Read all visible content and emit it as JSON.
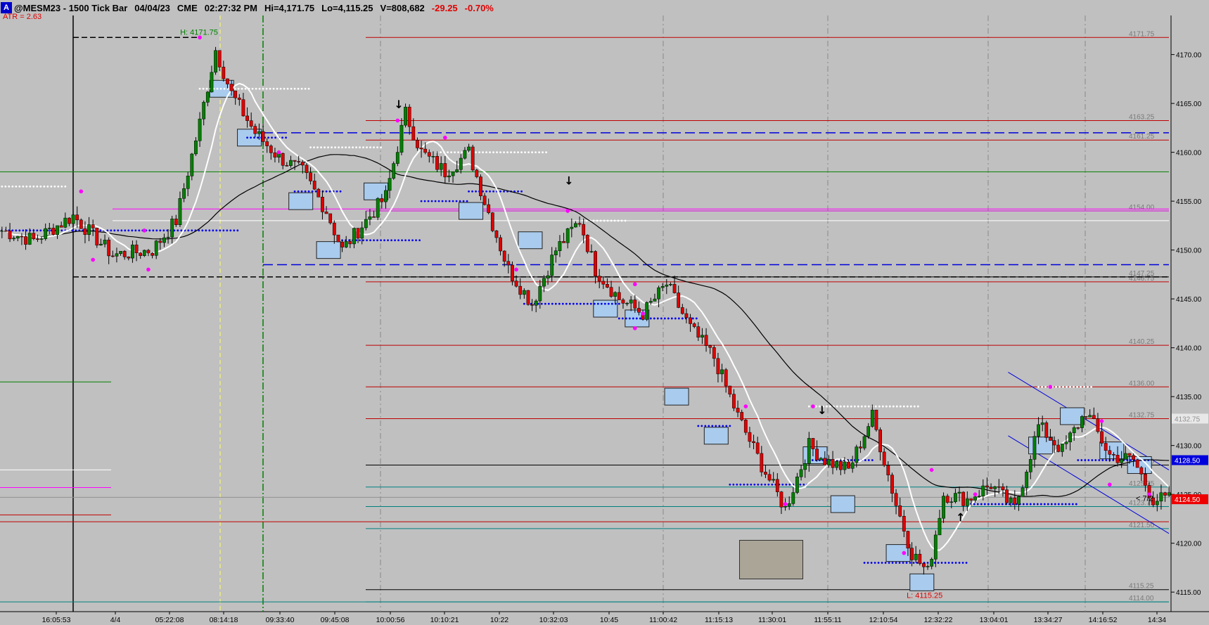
{
  "header": {
    "badge": "A",
    "symbol": "@MESM23 - 1500 Tick Bar",
    "date": "04/04/23",
    "exchange": "CME",
    "time": "02:27:32 PM",
    "hi": "Hi=4,171.75",
    "lo": "Lo=4,115.25",
    "volume": "V=808,682",
    "change": "-29.25",
    "change_pct": "-0.70%"
  },
  "atr_label": "ATR  = 2.63",
  "chart_data": {
    "type": "candlestick",
    "y_range": [
      4113,
      4174
    ],
    "y_ticks": [
      4115,
      4120,
      4125,
      4130,
      4135,
      4140,
      4145,
      4150,
      4155,
      4160,
      4165,
      4170
    ],
    "y_tick_labels": [
      "4115.00",
      "4120.00",
      "4125.00",
      "4130.00",
      "4135.00",
      "4140.00",
      "4145.00",
      "4150.00",
      "4155.00",
      "4160.00",
      "4165.00",
      "4170.00"
    ],
    "x_labels": [
      "16:05:53",
      "4/4",
      "05:22:08",
      "08:14:18",
      "09:33:40",
      "09:45:08",
      "10:00:56",
      "10:10:21",
      "10:22",
      "10:32:03",
      "10:45",
      "11:00:42",
      "11:15:13",
      "11:30:01",
      "11:55:11",
      "12:10:54",
      "12:32:22",
      "13:04:01",
      "13:34:27",
      "14:16:52",
      "14:34"
    ],
    "bar_count": 296,
    "close_path": [
      [
        0,
        4152
      ],
      [
        8,
        4151
      ],
      [
        18,
        4153.5
      ],
      [
        28,
        4149.5
      ],
      [
        38,
        4150
      ],
      [
        44,
        4153
      ],
      [
        50,
        4163
      ],
      [
        54,
        4170.5
      ],
      [
        58,
        4166
      ],
      [
        64,
        4162
      ],
      [
        70,
        4159.5
      ],
      [
        76,
        4158
      ],
      [
        82,
        4154
      ],
      [
        86,
        4150
      ],
      [
        92,
        4153
      ],
      [
        97,
        4155.5
      ],
      [
        102,
        4164
      ],
      [
        106,
        4160
      ],
      [
        112,
        4158
      ],
      [
        118,
        4160
      ],
      [
        122,
        4155
      ],
      [
        128,
        4148
      ],
      [
        134,
        4144.5
      ],
      [
        140,
        4150
      ],
      [
        146,
        4153
      ],
      [
        150,
        4148
      ],
      [
        156,
        4145
      ],
      [
        162,
        4143.5
      ],
      [
        168,
        4146.5
      ],
      [
        174,
        4142
      ],
      [
        180,
        4139
      ],
      [
        186,
        4133
      ],
      [
        192,
        4128
      ],
      [
        198,
        4123.5
      ],
      [
        204,
        4130
      ],
      [
        208,
        4128.5
      ],
      [
        214,
        4127.5
      ],
      [
        220,
        4133
      ],
      [
        226,
        4124
      ],
      [
        230,
        4119
      ],
      [
        234,
        4117
      ],
      [
        238,
        4125
      ],
      [
        244,
        4124.5
      ],
      [
        250,
        4126
      ],
      [
        256,
        4123.5
      ],
      [
        262,
        4132
      ],
      [
        268,
        4129.5
      ],
      [
        274,
        4133.5
      ],
      [
        280,
        4129
      ],
      [
        286,
        4128.5
      ],
      [
        291,
        4124.5
      ],
      [
        295,
        4124.5
      ]
    ],
    "highs": [
      {
        "bar": 50,
        "price": 4171.75
      },
      {
        "bar": 100,
        "price": 4163.25
      },
      {
        "bar": 143,
        "price": 4154
      },
      {
        "bar": 265,
        "price": 4136
      }
    ],
    "lows": [
      {
        "bar": 234,
        "price": 4115.25
      }
    ],
    "annotations": {
      "high_label": "H: 4171.75",
      "low_label": "L: 4115.25",
      "last_price": "4124.50",
      "bid_price": "4128.50",
      "ask_price": "4132.75",
      "countdown": "< 7/2"
    },
    "levels": [
      {
        "price": 4171.75,
        "label": "4171.75"
      },
      {
        "price": 4163.25,
        "label": "4163.25"
      },
      {
        "price": 4161.25,
        "label": "4161.25"
      },
      {
        "price": 4154.0,
        "label": "4154.00"
      },
      {
        "price": 4147.25,
        "label": "4147.25"
      },
      {
        "price": 4146.75,
        "label": "4146.75"
      },
      {
        "price": 4140.25,
        "label": "4140.25"
      },
      {
        "price": 4136.0,
        "label": "4136.00"
      },
      {
        "price": 4132.75,
        "label": "4132.75"
      },
      {
        "price": 4128.0,
        "label": "4128.00"
      },
      {
        "price": 4125.75,
        "label": "4125.75"
      },
      {
        "price": 4123.75,
        "label": "4123.75"
      },
      {
        "price": 4121.5,
        "label": "4121.50"
      },
      {
        "price": 4115.25,
        "label": "4115.25"
      },
      {
        "price": 4114.0,
        "label": "4114.00"
      }
    ],
    "arrows_down": [
      100,
      143,
      207
    ],
    "arrows_up": [
      242
    ],
    "colors": {
      "background": "#c0c0c0",
      "up_candle": "#008000",
      "down_candle": "#e00000",
      "fast_ma": "#ffffff",
      "slow_ma": "#000000",
      "pivot": "#ff00ff",
      "box_fill": "#a9cbed",
      "channel": "#0000dd"
    }
  }
}
